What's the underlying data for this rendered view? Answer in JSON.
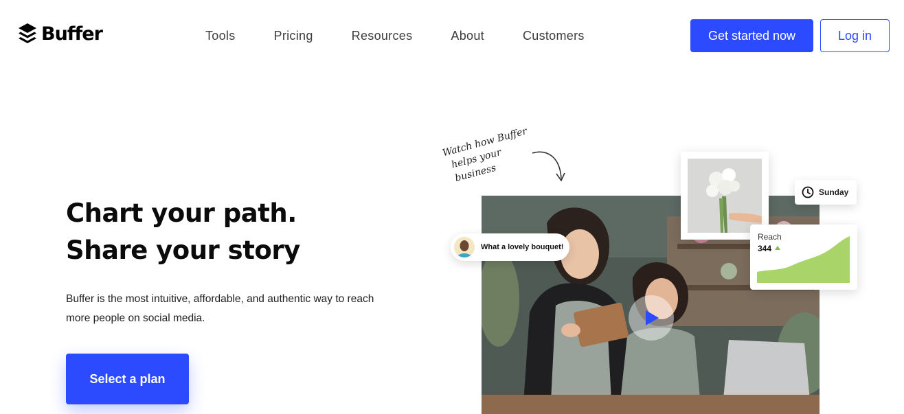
{
  "header": {
    "brand": "Buffer",
    "nav": [
      "Tools",
      "Pricing",
      "Resources",
      "About",
      "Customers"
    ],
    "cta_label": "Get started now",
    "login_label": "Log in"
  },
  "hero": {
    "title_line1": "Chart your path.",
    "title_line2": "Share your story",
    "subtitle": "Buffer is the most intuitive, affordable, and authentic way to reach more people on social media.",
    "cta_label": "Select a plan"
  },
  "media": {
    "note_line1": "Watch how Buffer",
    "note_line2": "helps your business",
    "comment_text": "What a lovely bouquet!",
    "day_label": "Sunday",
    "reach_label": "Reach",
    "reach_value": "344"
  },
  "colors": {
    "brand_blue": "#2c4bff",
    "reach_green": "#a8d46a"
  },
  "icons": {
    "logo": "buffer-layers-icon",
    "clock": "clock-icon",
    "play": "play-icon",
    "trend": "arrow-up-icon"
  }
}
